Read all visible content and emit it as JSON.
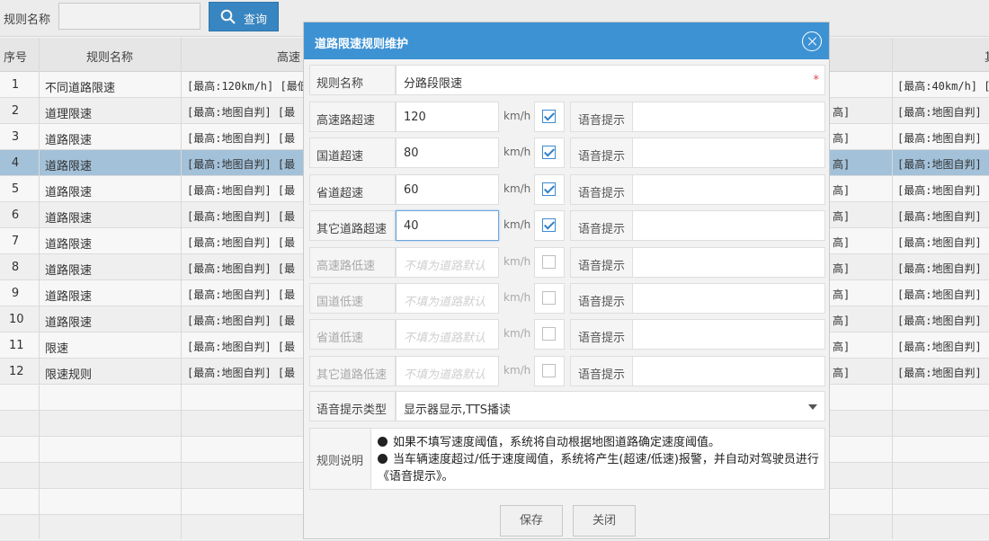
{
  "toolbar": {
    "rule_name_label": "规则名称",
    "rule_name_value": "",
    "query_label": "查询"
  },
  "table": {
    "headers": [
      "序号",
      "规则名称",
      "高速",
      "",
      "其"
    ],
    "rows": [
      {
        "no": "1",
        "name": "不同道路限速",
        "highway": "[最高:120km/h] [最低",
        "col4": "",
        "col5": "[最高:40km/h] ["
      },
      {
        "no": "2",
        "name": "道理限速",
        "highway": "[最高:地图自判] [最",
        "col4": "高]",
        "col5": "[最高:地图自判]"
      },
      {
        "no": "3",
        "name": "道路限速",
        "highway": "[最高:地图自判] [最",
        "col4": "高]",
        "col5": "[最高:地图自判]"
      },
      {
        "no": "4",
        "name": "道路限速",
        "highway": "[最高:地图自判] [最",
        "col4": "高]",
        "col5": "[最高:地图自判]"
      },
      {
        "no": "5",
        "name": "道路限速",
        "highway": "[最高:地图自判] [最",
        "col4": "高]",
        "col5": "[最高:地图自判]"
      },
      {
        "no": "6",
        "name": "道路限速",
        "highway": "[最高:地图自判] [最",
        "col4": "高]",
        "col5": "[最高:地图自判]"
      },
      {
        "no": "7",
        "name": "道路限速",
        "highway": "[最高:地图自判] [最",
        "col4": "高]",
        "col5": "[最高:地图自判]"
      },
      {
        "no": "8",
        "name": "道路限速",
        "highway": "[最高:地图自判] [最",
        "col4": "高]",
        "col5": "[最高:地图自判]"
      },
      {
        "no": "9",
        "name": "道路限速",
        "highway": "[最高:地图自判] [最",
        "col4": "高]",
        "col5": "[最高:地图自判]"
      },
      {
        "no": "10",
        "name": "道路限速",
        "highway": "[最高:地图自判] [最",
        "col4": "高]",
        "col5": "[最高:地图自判]"
      },
      {
        "no": "11",
        "name": "限速",
        "highway": "[最高:地图自判] [最",
        "col4": "高]",
        "col5": "[最高:地图自判]"
      },
      {
        "no": "12",
        "name": "限速规则",
        "highway": "[最高:地图自判] [最",
        "col4": "高]",
        "col5": "[最高:地图自判]"
      }
    ],
    "selected_index": 3
  },
  "dialog": {
    "title": "道路限速规则维护",
    "rule_name_label": "规则名称",
    "rule_name_value": "分路段限速",
    "required_mark": "*",
    "unit": "km/h",
    "voice_label": "语音提示",
    "placeholder": "不填为道路默认",
    "speed_rows": [
      {
        "label": "高速路超速",
        "value": "120",
        "checked": true,
        "enabled": true
      },
      {
        "label": "国道超速",
        "value": "80",
        "checked": true,
        "enabled": true
      },
      {
        "label": "省道超速",
        "value": "60",
        "checked": true,
        "enabled": true
      },
      {
        "label": "其它道路超速",
        "value": "40",
        "checked": true,
        "enabled": true
      },
      {
        "label": "高速路低速",
        "value": "",
        "checked": false,
        "enabled": false
      },
      {
        "label": "国道低速",
        "value": "",
        "checked": false,
        "enabled": false
      },
      {
        "label": "省道低速",
        "value": "",
        "checked": false,
        "enabled": false
      },
      {
        "label": "其它道路低速",
        "value": "",
        "checked": false,
        "enabled": false
      }
    ],
    "voice_type_label": "语音提示类型",
    "voice_type_value": "显示器显示,TTS播读",
    "desc_label": "规则说明",
    "desc_line1": "如果不填写速度阈值，系统将自动根据地图道路确定速度阈值。",
    "desc_line2": "当车辆速度超过/低于速度阈值，系统将产生(超速/低速)报警，并自动对驾驶员进行《语音提示》。",
    "save_label": "保存",
    "close_label": "关闭"
  },
  "colors": {
    "header_blue": "#3d92d4",
    "query_button": "#3a8bc8",
    "selected_row": "#a9c8e0",
    "required_star": "#e0464e"
  },
  "icons": [
    "search-icon",
    "close-icon",
    "dropdown-caret-icon",
    "bullet-icon"
  ]
}
